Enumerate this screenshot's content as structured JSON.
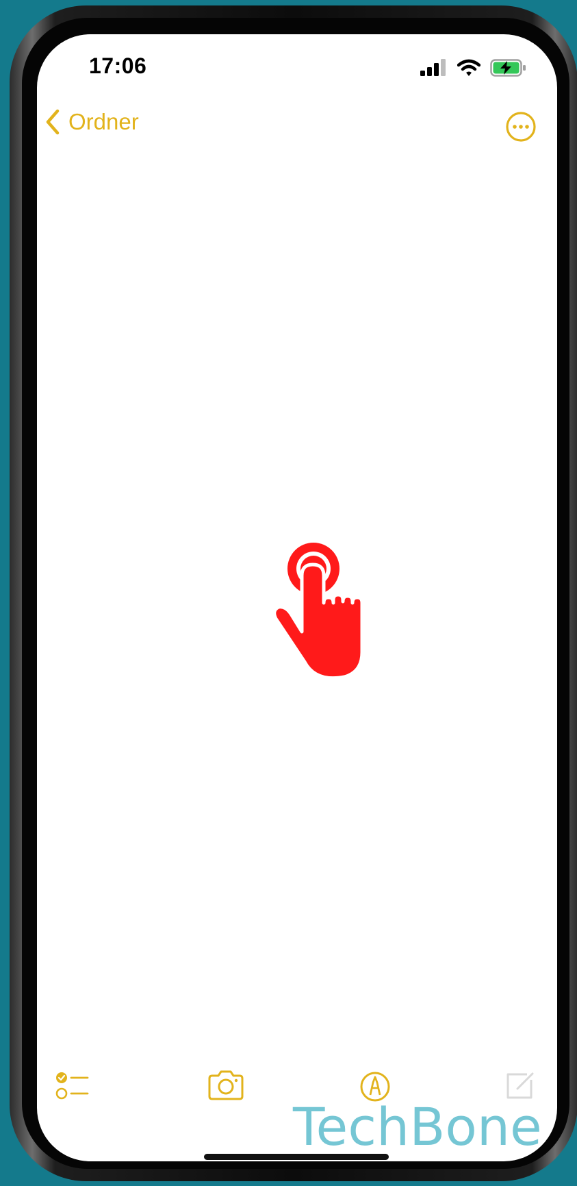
{
  "status_bar": {
    "time": "17:06",
    "icons": [
      "cellular-signal-icon",
      "wifi-icon",
      "battery-charging-icon"
    ]
  },
  "nav": {
    "back_label": "Ordner",
    "more_icon": "ellipsis-circle-icon"
  },
  "overlay": {
    "gesture_icon": "tap-hand-icon"
  },
  "toolbar": {
    "items": [
      "checklist-icon",
      "camera-icon",
      "markup-icon",
      "compose-icon"
    ]
  },
  "watermark": {
    "text": "TechBone"
  },
  "colors": {
    "accent": "#e2b31c",
    "tap_indicator": "#ff1a1a",
    "background": "#147a8c",
    "watermark": "#6ec3d2",
    "battery": "#34c759"
  }
}
